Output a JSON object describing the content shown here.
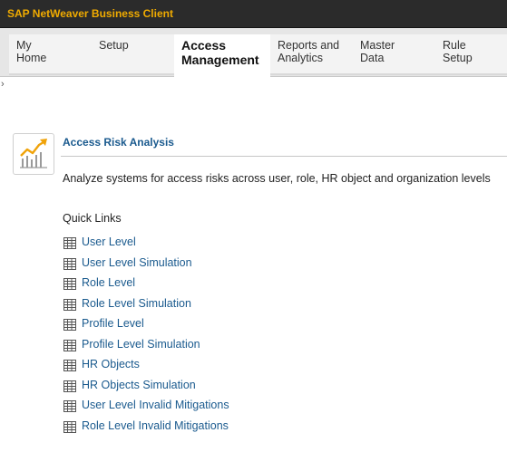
{
  "window": {
    "title": "SAP NetWeaver Business Client"
  },
  "navbar": {
    "tabs": [
      {
        "line1": "My",
        "line2": "Home",
        "active": false
      },
      {
        "line1": "Setup",
        "line2": "",
        "active": false
      },
      {
        "line1": "Access",
        "line2": "Management",
        "active": true
      },
      {
        "line1": "Reports and",
        "line2": "Analytics",
        "active": false
      },
      {
        "line1": "Master",
        "line2": "Data",
        "active": false
      },
      {
        "line1": "Rule",
        "line2": "Setup",
        "active": false
      }
    ]
  },
  "expander_glyph": "›",
  "page": {
    "icon": "chart-trend-icon",
    "title": "Access Risk Analysis",
    "description": "Analyze systems for access risks across user, role, HR object and organization levels"
  },
  "quick_links": {
    "heading": "Quick Links",
    "items_icon": "table-icon",
    "items": [
      {
        "label": "User Level"
      },
      {
        "label": "User Level Simulation"
      },
      {
        "label": "Role Level"
      },
      {
        "label": "Role Level Simulation"
      },
      {
        "label": "Profile Level"
      },
      {
        "label": "Profile Level Simulation"
      },
      {
        "label": "HR Objects"
      },
      {
        "label": "HR Objects Simulation"
      },
      {
        "label": "User Level Invalid Mitigations"
      },
      {
        "label": "Role Level Invalid Mitigations"
      }
    ]
  },
  "colors": {
    "title_text": "#f0ab00",
    "titlebar_bg": "#2b2b2b",
    "link": "#1a5a8e",
    "icon_orange": "#f0a30a"
  }
}
